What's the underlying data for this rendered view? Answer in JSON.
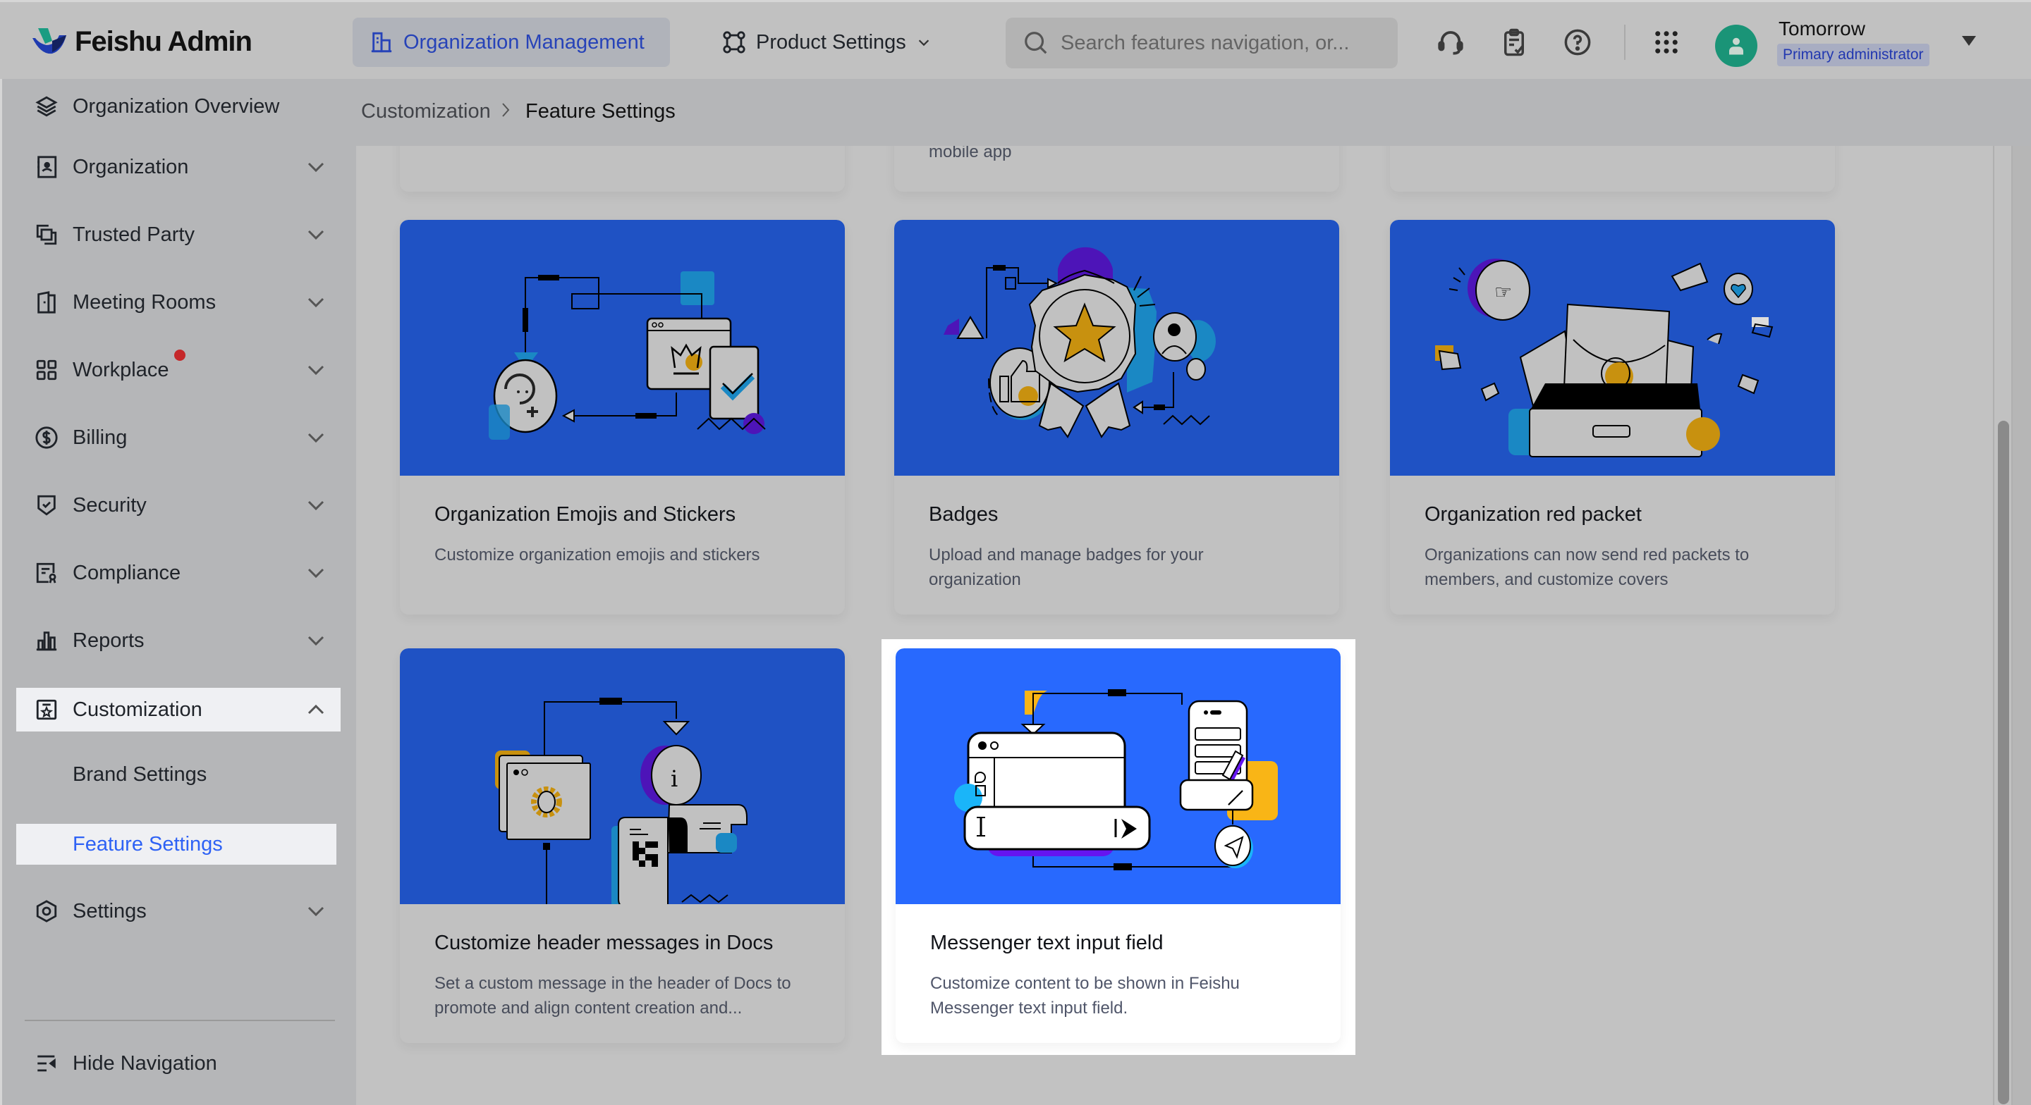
{
  "app": {
    "title": "Feishu Admin"
  },
  "topbar": {
    "tabs": [
      {
        "label": "Organization Management",
        "icon": "building-icon",
        "active": true
      },
      {
        "label": "Product Settings",
        "icon": "nodes-icon",
        "active": false,
        "has_dropdown": true
      }
    ],
    "search": {
      "placeholder": "Search features navigation, or..."
    },
    "icons": [
      "headset-icon",
      "clipboard-check-icon",
      "help-icon",
      "apps-grid-icon"
    ],
    "user": {
      "name": "Tomorrow",
      "role": "Primary administrator",
      "avatar_color": "#1a9477"
    }
  },
  "sidebar": {
    "items": [
      {
        "label": "Organization Overview",
        "icon": "layers-icon",
        "expandable": false
      },
      {
        "label": "Organization",
        "icon": "contact-book-icon",
        "expandable": true
      },
      {
        "label": "Trusted Party",
        "icon": "linked-squares-icon",
        "expandable": true
      },
      {
        "label": "Meeting Rooms",
        "icon": "door-icon",
        "expandable": true
      },
      {
        "label": "Workplace",
        "icon": "grid-icon",
        "expandable": true,
        "badge_dot": true
      },
      {
        "label": "Billing",
        "icon": "dollar-icon",
        "expandable": true
      },
      {
        "label": "Security",
        "icon": "shield-check-icon",
        "expandable": true
      },
      {
        "label": "Compliance",
        "icon": "certificate-icon",
        "expandable": true
      },
      {
        "label": "Reports",
        "icon": "bar-chart-icon",
        "expandable": true
      },
      {
        "label": "Customization",
        "icon": "star-frame-icon",
        "expandable": true,
        "expanded": true,
        "children": [
          {
            "label": "Brand Settings",
            "active": false
          },
          {
            "label": "Feature Settings",
            "active": true
          }
        ]
      },
      {
        "label": "Settings",
        "icon": "hex-gear-icon",
        "expandable": true
      }
    ],
    "footer": {
      "label": "Hide Navigation",
      "icon": "collapse-menu-icon"
    }
  },
  "breadcrumb": {
    "items": [
      "Customization",
      "Feature Settings"
    ]
  },
  "content": {
    "partial_row": [
      {
        "desc_tail": ""
      },
      {
        "desc_tail": "mobile app"
      },
      {
        "desc_tail": ""
      }
    ],
    "cards": [
      {
        "title": "Organization Emojis and Stickers",
        "desc": "Customize organization emojis and stickers",
        "illustration": "emoji-illustration",
        "highlighted": false
      },
      {
        "title": "Badges",
        "desc": "Upload and manage badges for your organization",
        "illustration": "badge-illustration",
        "highlighted": false
      },
      {
        "title": "Organization red packet",
        "desc": "Organizations can now send red packets to members, and customize covers",
        "illustration": "red-packet-illustration",
        "highlighted": false
      },
      {
        "title": "Customize header messages in Docs",
        "desc": "Set a custom message in the header of Docs to promote and align content creation and...",
        "illustration": "docs-header-illustration",
        "highlighted": false
      },
      {
        "title": "Messenger text input field",
        "desc": "Customize content to be shown in Feishu Messenger text input field.",
        "illustration": "messenger-input-illustration",
        "highlighted": true
      }
    ]
  },
  "colors": {
    "accent": "#2e62f5",
    "card_art_blue": "#2869fe",
    "active_tab_text": "#2743b8",
    "notification_dot": "#c5282a"
  }
}
